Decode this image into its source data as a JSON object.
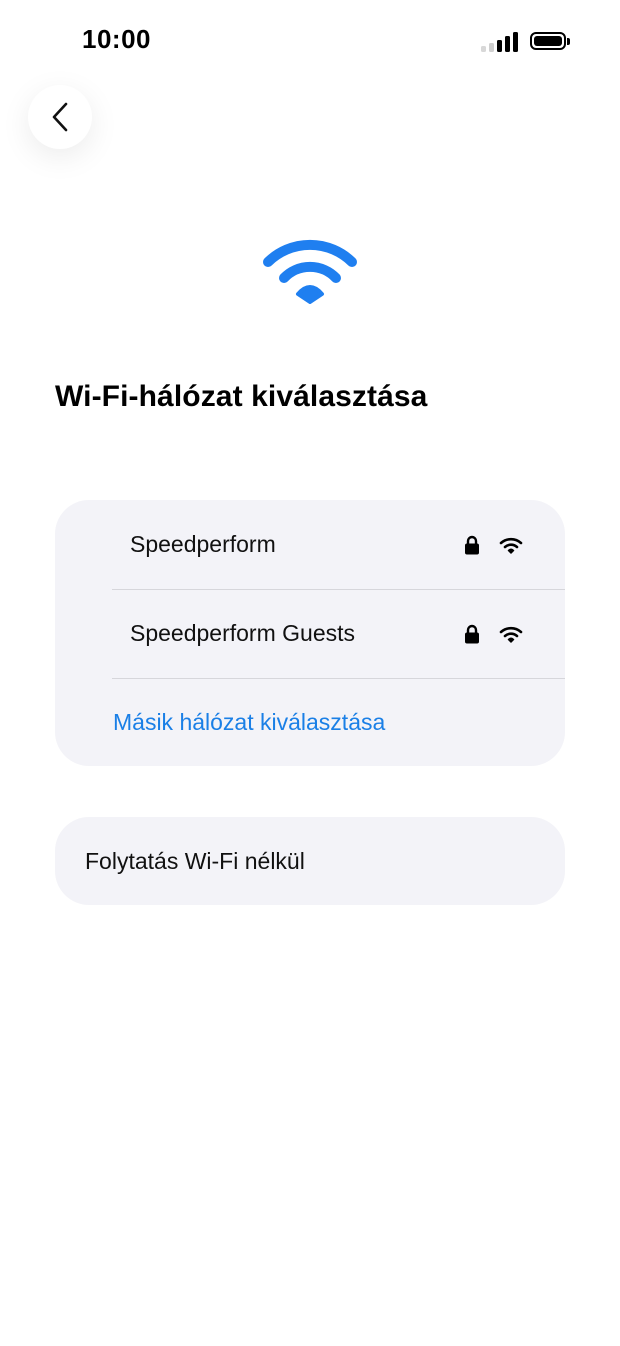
{
  "status_bar": {
    "time": "10:00"
  },
  "icons": {
    "back": "chevron-left-icon",
    "hero": "wifi-icon",
    "lock": "lock-icon",
    "row_wifi": "wifi-icon"
  },
  "colors": {
    "accent": "#1a7fe6",
    "hero_wifi": "#1f7ff0",
    "card_bg": "#f3f3f8"
  },
  "page": {
    "title": "Wi-Fi-hálózat kiválasztása"
  },
  "networks": [
    {
      "name": "Speedperform",
      "secured": true
    },
    {
      "name": "Speedperform Guests",
      "secured": true
    }
  ],
  "other_network_label": "Másik hálózat kiválasztása",
  "continue_without_wifi_label": "Folytatás Wi-Fi nélkül"
}
